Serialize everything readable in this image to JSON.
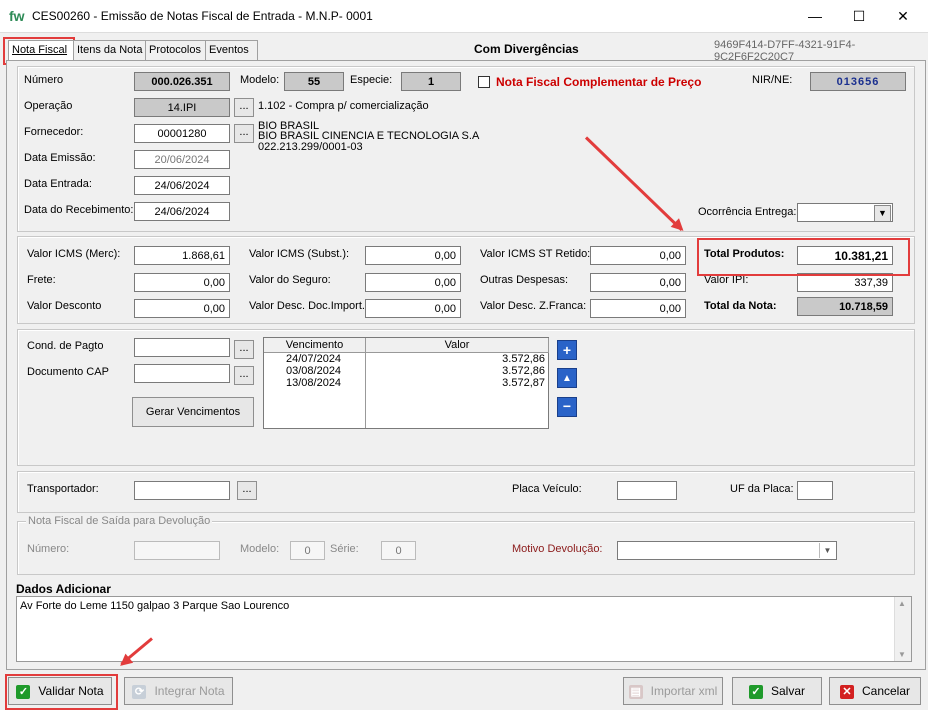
{
  "window": {
    "logo": "fw",
    "title": "CES00260 - Emissão de  Notas  Fiscal de Entrada - M.N.P- 0001",
    "min": "—",
    "max": "☐",
    "close": "✕"
  },
  "tabs": [
    "Nota Fiscal",
    "Itens da Nota",
    "Protocolos",
    "Eventos"
  ],
  "status": "Com Divergências",
  "guid": "9469F414-D7FF-4321-91F4-9C2F6F2C20C7",
  "header": {
    "numero_label": "Número",
    "numero": "000.026.351",
    "modelo_label": "Modelo:",
    "modelo": "55",
    "especie_label": "Especie:",
    "especie": "1",
    "complementar_label": "Nota Fiscal Complementar de Preço",
    "nir_label": "NIR/NE:",
    "nir": "013656",
    "operacao_label": "Operação",
    "operacao": "14.IPI",
    "operacao_desc": "1.102 - Compra p/ comercialização",
    "fornecedor_label": "Fornecedor:",
    "fornecedor": "00001280",
    "forn_line1": "BIO BRASIL",
    "forn_line2": "BIO BRASIL CINENCIA E TECNOLOGIA S.A",
    "forn_line3": "022.213.299/0001-03",
    "emissao_label": "Data Emissão:",
    "emissao": "20/06/2024",
    "entrada_label": "Data Entrada:",
    "entrada": "24/06/2024",
    "recebimento_label": "Data do Recebimento:",
    "recebimento": "24/06/2024",
    "ocorrencia_label": "Ocorrência Entrega:"
  },
  "valores": {
    "icms_merc_label": "Valor ICMS (Merc):",
    "icms_merc": "1.868,61",
    "icms_subst_label": "Valor  ICMS (Subst.):",
    "icms_subst": "0,00",
    "icms_st_label": "Valor ICMS ST Retido:",
    "icms_st": "0,00",
    "total_produtos_label": "Total Produtos:",
    "total_produtos": "10.381,21",
    "frete_label": "Frete:",
    "frete": "0,00",
    "seguro_label": "Valor do Seguro:",
    "seguro": "0,00",
    "outras_label": "Outras Despesas:",
    "outras": "0,00",
    "ipi_label": "Valor IPI:",
    "ipi": "337,39",
    "desconto_label": "Valor Desconto",
    "desconto": "0,00",
    "desc_import_label": "Valor Desc. Doc.Import.",
    "desc_import": "0,00",
    "desc_zf_label": "Valor Desc. Z.Franca:",
    "desc_zf": "0,00",
    "total_nota_label": "Total da Nota:",
    "total_nota": "10.718,59"
  },
  "pagamento": {
    "cond_label": "Cond. de Pagto",
    "doc_label": "Documento CAP",
    "gerar_label": "Gerar Vencimentos",
    "col_venc": "Vencimento",
    "col_valor": "Valor",
    "rows": [
      {
        "venc": "24/07/2024",
        "valor": "3.572,86"
      },
      {
        "venc": "03/08/2024",
        "valor": "3.572,86"
      },
      {
        "venc": "13/08/2024",
        "valor": "3.572,87"
      }
    ]
  },
  "transporte": {
    "transportador_label": "Transportador:",
    "placa_label": "Placa Veículo:",
    "uf_label": "UF da Placa:"
  },
  "devolucao": {
    "legend": "Nota Fiscal de Saída para Devolução",
    "numero_label": "Número:",
    "modelo_label": "Modelo:",
    "modelo": "0",
    "serie_label": "Série:",
    "serie": "0",
    "motivo_label": "Motivo Devolução:"
  },
  "adicionais": {
    "label": "Dados Adicionar",
    "text": "Av Forte do Leme 1150 galpao 3 Parque Sao Lourenco"
  },
  "buttons": {
    "validar": "Validar Nota",
    "integrar": "Integrar Nota",
    "importar": "Importar xml",
    "salvar": "Salvar",
    "cancelar": "Cancelar",
    "ellipsis": "..."
  },
  "colors": {
    "accent_red": "#e23c3c",
    "nir_blue": "#1a2f8f",
    "complement_red": "#cc0000"
  }
}
